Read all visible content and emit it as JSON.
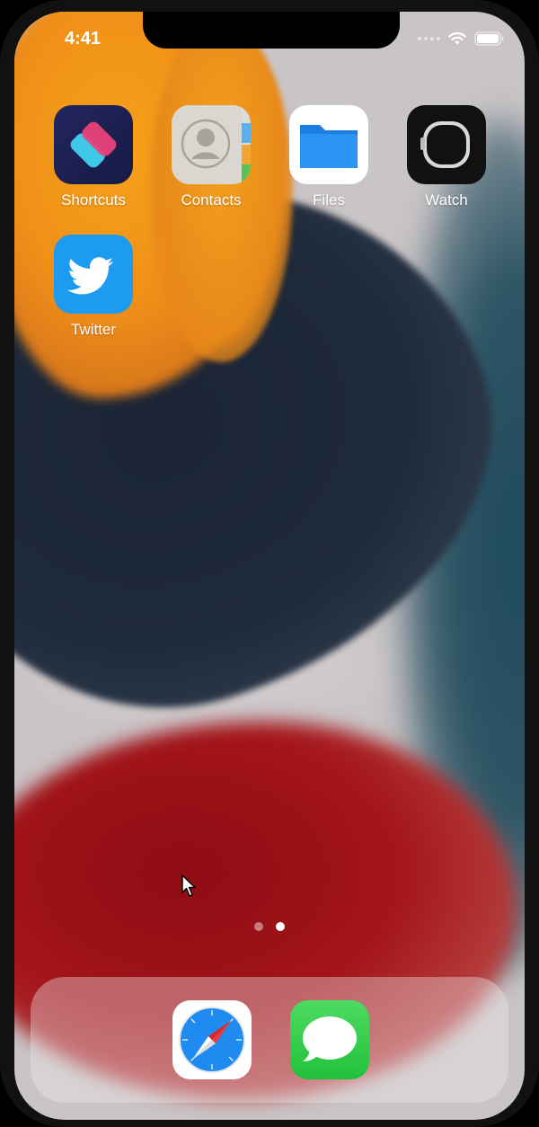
{
  "status_bar": {
    "time": "4:41"
  },
  "apps": [
    {
      "name": "Shortcuts",
      "icon": "shortcuts-icon"
    },
    {
      "name": "Contacts",
      "icon": "contacts-icon"
    },
    {
      "name": "Files",
      "icon": "files-icon"
    },
    {
      "name": "Watch",
      "icon": "watch-icon"
    },
    {
      "name": "Twitter",
      "icon": "twitter-icon"
    }
  ],
  "dock": [
    {
      "icon": "safari-icon"
    },
    {
      "icon": "messages-icon"
    }
  ],
  "page_indicator": {
    "pages": 2,
    "current": 2
  },
  "colors": {
    "shortcuts_bg": "#1b1f4f",
    "files_bg": "#ffffff",
    "watch_bg": "#111111",
    "twitter_bg": "#1d9bf0",
    "messages_bg": "#2fcb4b",
    "safari_bg": "#ffffff"
  }
}
